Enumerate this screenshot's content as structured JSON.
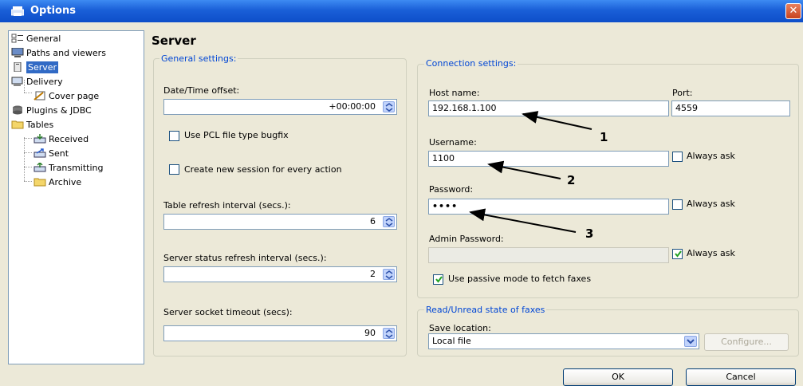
{
  "window": {
    "title": "Options",
    "close_glyph": "✕"
  },
  "sidebar": {
    "items": [
      {
        "label": "General",
        "icon": "general-icon"
      },
      {
        "label": "Paths and viewers",
        "icon": "monitor-icon"
      },
      {
        "label": "Server",
        "icon": "server-icon",
        "selected": true
      },
      {
        "label": "Delivery",
        "icon": "delivery-icon"
      },
      {
        "label": "Cover page",
        "icon": "cover-page-icon"
      },
      {
        "label": "Plugins & JDBC",
        "icon": "plugin-icon"
      },
      {
        "label": "Tables",
        "icon": "folder-icon"
      },
      {
        "label": "Received",
        "icon": "received-icon"
      },
      {
        "label": "Sent",
        "icon": "sent-icon"
      },
      {
        "label": "Transmitting",
        "icon": "transmitting-icon"
      },
      {
        "label": "Archive",
        "icon": "archive-folder-icon"
      }
    ]
  },
  "main": {
    "title": "Server",
    "general": {
      "legend": "General settings:",
      "datetime_label": "Date/Time offset:",
      "datetime_value": "+00:00:00",
      "pcl_label": "Use PCL file type bugfix",
      "pcl_checked": false,
      "new_session_label": "Create new session for every action",
      "new_session_checked": false,
      "table_refresh_label": "Table refresh interval (secs.):",
      "table_refresh_value": "6",
      "status_refresh_label": "Server status refresh interval (secs.):",
      "status_refresh_value": "2",
      "socket_timeout_label": "Server socket timeout (secs):",
      "socket_timeout_value": "90"
    },
    "connection": {
      "legend": "Connection settings:",
      "host_label": "Host name:",
      "host_value": "192.168.1.100",
      "port_label": "Port:",
      "port_value": "4559",
      "username_label": "Username:",
      "username_value": "1100",
      "username_always_ask": "Always ask",
      "username_always_checked": false,
      "password_label": "Password:",
      "password_value": "••••",
      "password_always_ask": "Always ask",
      "password_always_checked": false,
      "admin_password_label": "Admin Password:",
      "admin_password_value": "",
      "admin_always_ask": "Always ask",
      "admin_always_checked": true,
      "passive_label": "Use passive mode to fetch faxes",
      "passive_checked": true
    },
    "readstate": {
      "legend": "Read/Unread state of faxes",
      "save_location_label": "Save location:",
      "save_location_value": "Local file",
      "configure_label": "Configure..."
    }
  },
  "annotations": {
    "arrow1": "1",
    "arrow2": "2",
    "arrow3": "3"
  },
  "buttons": {
    "ok": "OK",
    "cancel": "Cancel"
  },
  "colors": {
    "selection": "#316ac5",
    "legend": "#0046d5",
    "titlebar": "#1a5fd8"
  }
}
